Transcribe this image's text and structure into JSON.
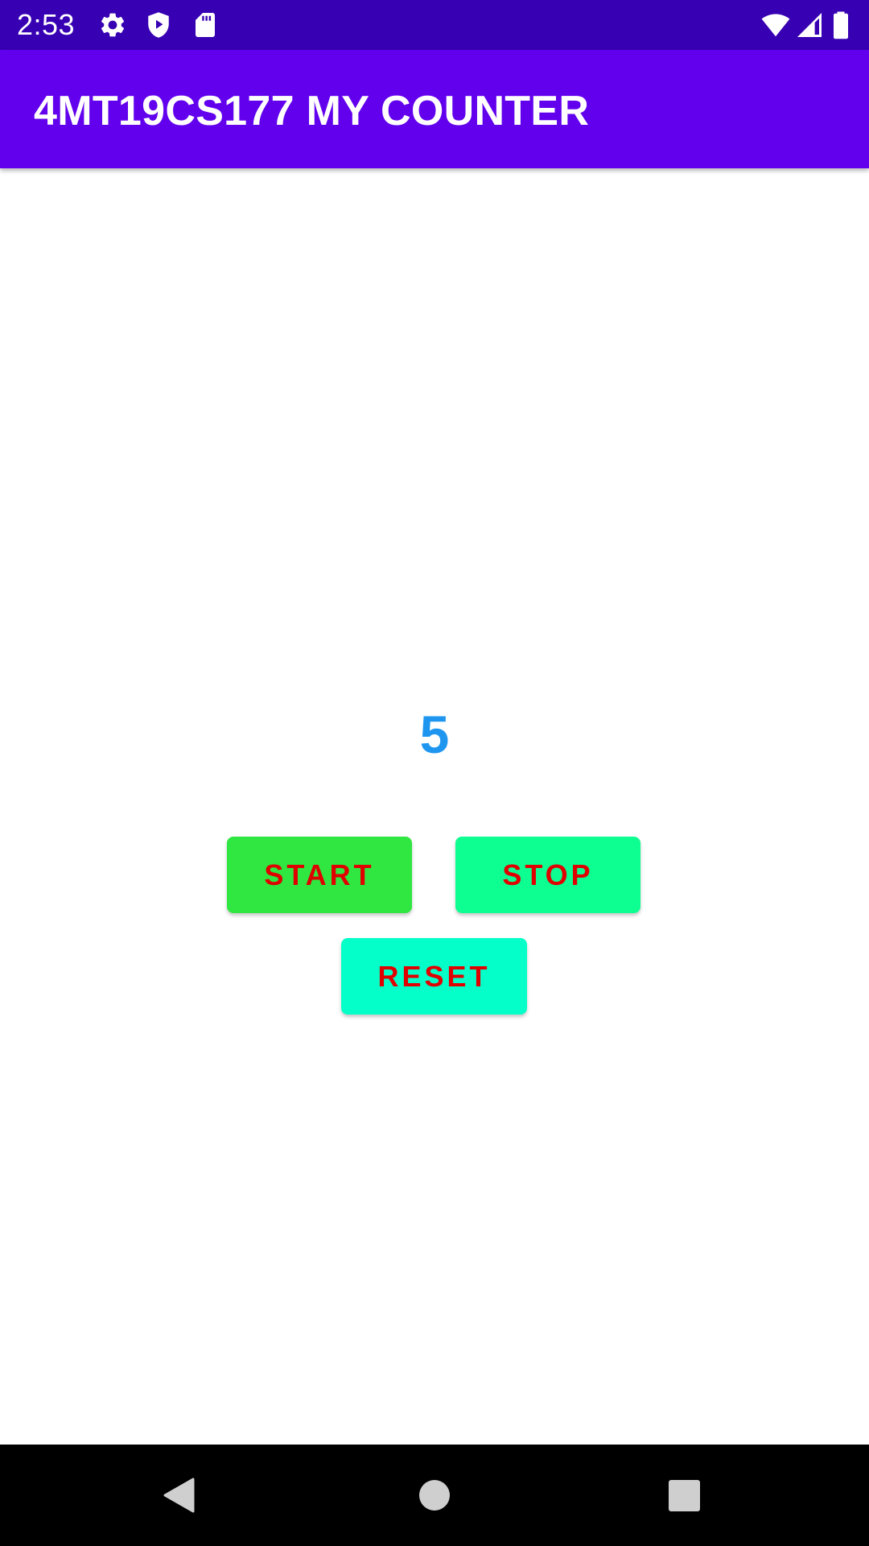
{
  "status_bar": {
    "time": "2:53",
    "icons": [
      "gear-icon",
      "shield-play-icon",
      "sd-card-icon",
      "wifi-icon",
      "cellular-signal-icon",
      "battery-icon"
    ],
    "background_color": "#3700b3"
  },
  "app_bar": {
    "title": "4MT19CS177 MY COUNTER",
    "background_color": "#6200ee"
  },
  "counter": {
    "value": "5",
    "color": "#1e96f0"
  },
  "buttons": {
    "start_label": "START",
    "stop_label": "STOP",
    "reset_label": "RESET",
    "label_color": "#e00000",
    "start_color": "#30e640",
    "stop_color": "#0dff92",
    "reset_color": "#05ffc8"
  },
  "nav_bar": {
    "icons": [
      "back-icon",
      "home-icon",
      "recents-icon"
    ]
  }
}
